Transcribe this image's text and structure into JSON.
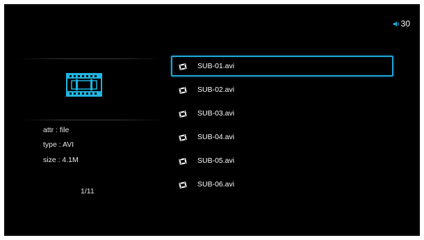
{
  "volume": {
    "icon": "speaker-icon",
    "level": "30",
    "accent_color": "#1fa4d6"
  },
  "info_panel": {
    "thumbnail_icon": "film-strip-icon",
    "attr": "attr : file",
    "type": "type : AVI",
    "size": "size : 4.1M",
    "page": "1/11"
  },
  "file_list": {
    "item_icon": "film-reel-icon",
    "selected_index": 0,
    "selection_color": "#1fa4d6",
    "items": [
      {
        "label": "SUB-01.avi"
      },
      {
        "label": "SUB-02.avi"
      },
      {
        "label": "SUB-03.avi"
      },
      {
        "label": "SUB-04.avi"
      },
      {
        "label": "SUB-05.avi"
      },
      {
        "label": "SUB-06.avi"
      }
    ]
  }
}
